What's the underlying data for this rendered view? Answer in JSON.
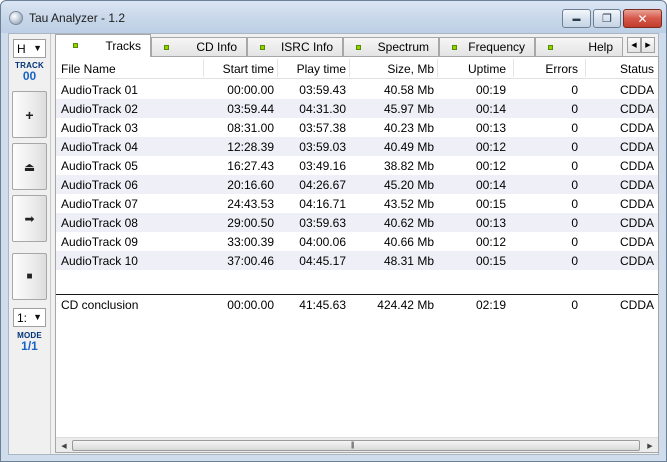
{
  "window": {
    "title": "Tau Analyzer - 1.2",
    "min_glyph": "▬",
    "max_glyph": "❐",
    "close_glyph": "✕"
  },
  "sidebar": {
    "drive_select": "H",
    "track_label": "TRACK",
    "track_value": "00",
    "add_glyph": "+",
    "eject_glyph": "⏏",
    "next_glyph": "➡",
    "stop_glyph": "■",
    "mode_select": "1:",
    "mode_label": "MODE",
    "mode_value": "1/1",
    "dropdown_glyph": "▼"
  },
  "tabs": [
    {
      "label": "Tracks",
      "active": true
    },
    {
      "label": "CD Info"
    },
    {
      "label": "ISRC Info"
    },
    {
      "label": "Spectrum"
    },
    {
      "label": "Frequency"
    },
    {
      "label": "Help"
    }
  ],
  "tab_scroll": {
    "left": "◀",
    "right": "▶"
  },
  "grid": {
    "columns": [
      "File Name",
      "Start time",
      "Play time",
      "Size, Mb",
      "Uptime",
      "Errors",
      "Status"
    ],
    "rows": [
      [
        "AudioTrack 01",
        "00:00.00",
        "03:59.43",
        "40.58 Mb",
        "00:19",
        "0",
        "CDDA"
      ],
      [
        "AudioTrack 02",
        "03:59.44",
        "04:31.30",
        "45.97 Mb",
        "00:14",
        "0",
        "CDDA"
      ],
      [
        "AudioTrack 03",
        "08:31.00",
        "03:57.38",
        "40.23 Mb",
        "00:13",
        "0",
        "CDDA"
      ],
      [
        "AudioTrack 04",
        "12:28.39",
        "03:59.03",
        "40.49 Mb",
        "00:12",
        "0",
        "CDDA"
      ],
      [
        "AudioTrack 05",
        "16:27.43",
        "03:49.16",
        "38.82 Mb",
        "00:12",
        "0",
        "CDDA"
      ],
      [
        "AudioTrack 06",
        "20:16.60",
        "04:26.67",
        "45.20 Mb",
        "00:14",
        "0",
        "CDDA"
      ],
      [
        "AudioTrack 07",
        "24:43.53",
        "04:16.71",
        "43.52 Mb",
        "00:15",
        "0",
        "CDDA"
      ],
      [
        "AudioTrack 08",
        "29:00.50",
        "03:59.63",
        "40.62 Mb",
        "00:13",
        "0",
        "CDDA"
      ],
      [
        "AudioTrack 09",
        "33:00.39",
        "04:00.06",
        "40.66 Mb",
        "00:12",
        "0",
        "CDDA"
      ],
      [
        "AudioTrack 10",
        "37:00.46",
        "04:45.17",
        "48.31 Mb",
        "00:15",
        "0",
        "CDDA"
      ]
    ],
    "summary": [
      "CD conclusion",
      "00:00.00",
      "41:45.63",
      "424.42 Mb",
      "02:19",
      "0",
      "CDDA"
    ]
  },
  "scrollbar": {
    "left": "◀",
    "right": "▶",
    "grip": "|||"
  },
  "colors": {
    "alt_row": "#efeff8",
    "tab_led": "#8fd400",
    "track_value": "#1a63c6"
  }
}
